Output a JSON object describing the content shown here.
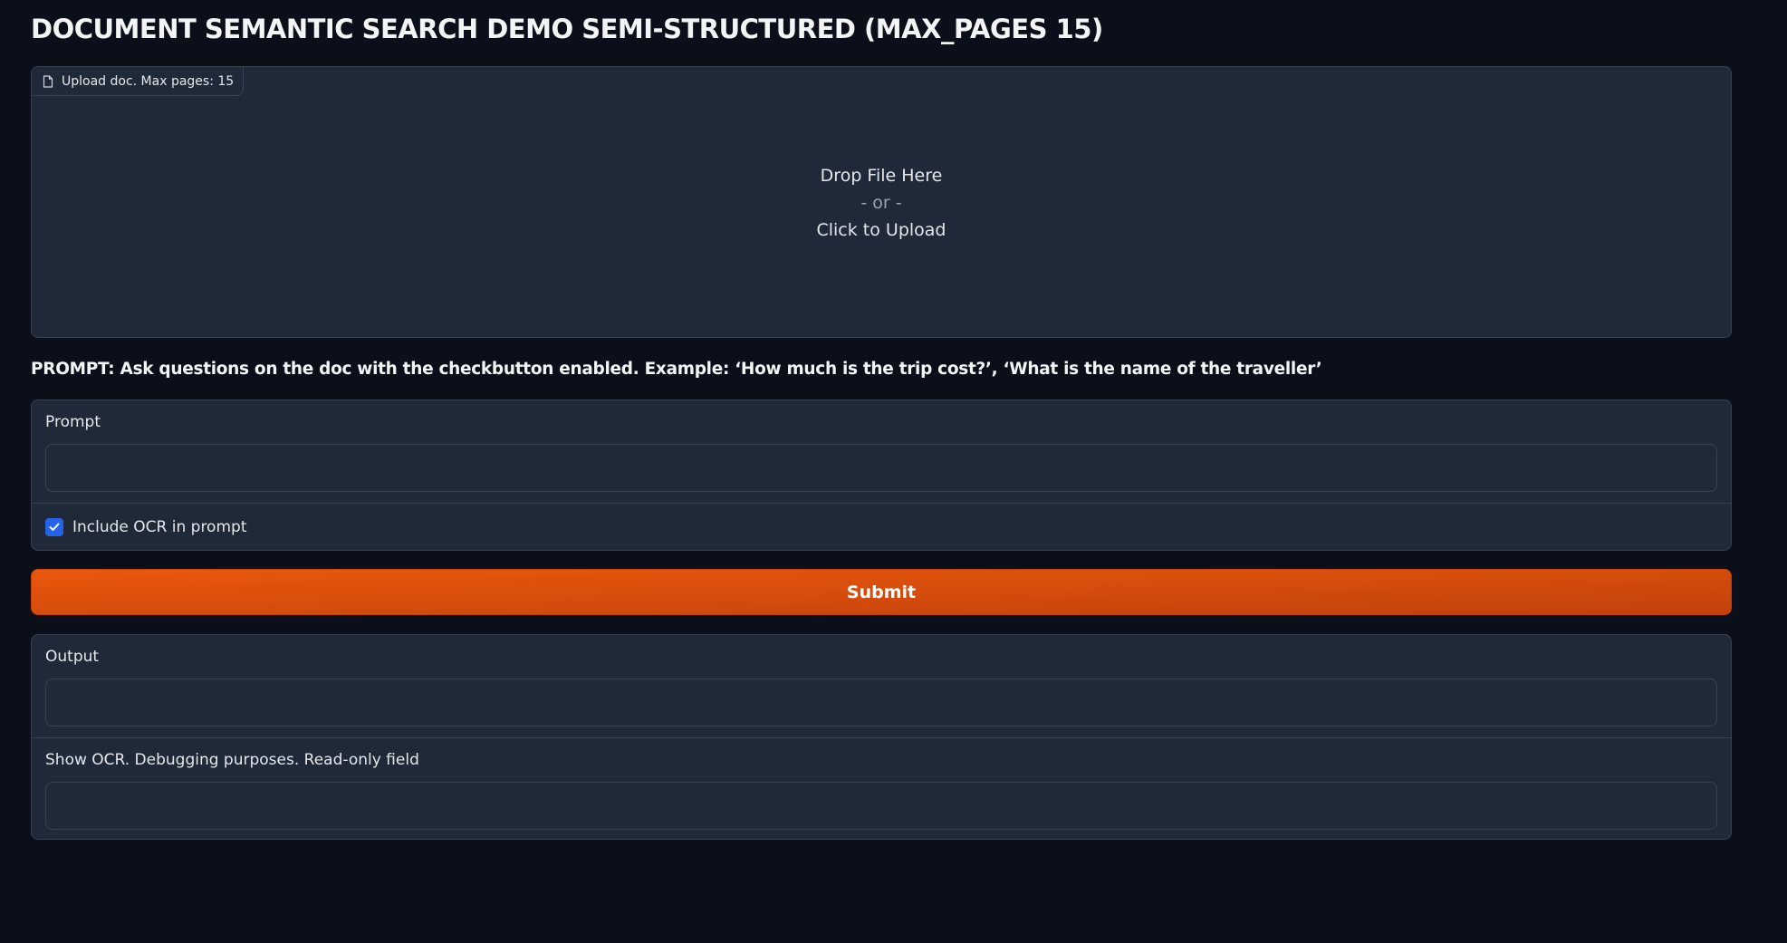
{
  "page": {
    "title": "DOCUMENT SEMANTIC SEARCH DEMO SEMI-STRUCTURED (MAX_PAGES 15)"
  },
  "upload": {
    "label": "Upload doc. Max pages: 15",
    "icon": "file-icon",
    "drop_text": "Drop File Here",
    "or_text": "- or -",
    "click_text": "Click to Upload"
  },
  "instructions": {
    "text": "PROMPT: Ask questions on the doc with the checkbutton enabled. Example: ‘How much is the trip cost?’, ‘What is the name of the traveller’"
  },
  "prompt": {
    "label": "Prompt",
    "value": "",
    "placeholder": ""
  },
  "ocr_checkbox": {
    "label": "Include OCR in prompt",
    "checked": true
  },
  "submit": {
    "label": "Submit"
  },
  "output": {
    "label": "Output",
    "value": ""
  },
  "ocr_output": {
    "label": "Show OCR. Debugging purposes. Read-only field",
    "value": ""
  },
  "colors": {
    "background": "#0b0f19",
    "panel": "#1f2937",
    "border": "#374151",
    "accent": "#ea580c",
    "checkbox": "#2563eb"
  }
}
